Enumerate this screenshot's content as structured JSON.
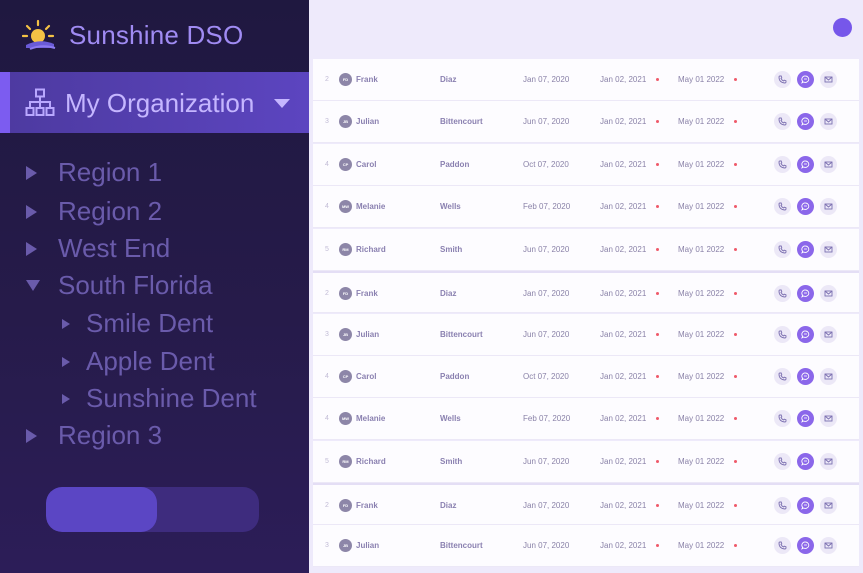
{
  "brand": {
    "name": "Sunshine DSO",
    "logo_icon": "sun-icon"
  },
  "org": {
    "label": "My Organization",
    "icon": "org-chart-icon",
    "caret_icon": "caret-down-icon"
  },
  "tree": [
    {
      "label": "Region 1",
      "expanded": false,
      "level": 0
    },
    {
      "label": "Region 2",
      "expanded": false,
      "level": 0
    },
    {
      "label": "West End",
      "expanded": false,
      "level": 0
    },
    {
      "label": "South Florida",
      "expanded": true,
      "level": 0
    },
    {
      "label": "Smile Dent",
      "expanded": false,
      "level": 1
    },
    {
      "label": "Apple Dent",
      "expanded": false,
      "level": 1
    },
    {
      "label": "Sunshine Dent",
      "expanded": false,
      "level": 1
    },
    {
      "label": "Region 3",
      "expanded": false,
      "level": 0
    }
  ],
  "toggle": {
    "fill_fraction": 0.52
  },
  "colors": {
    "accent": "#7657ea",
    "sidebar_bg": "#1f1840",
    "status_dot": "#ef5a6a"
  },
  "rows": [
    {
      "num": "2",
      "initials": "FD",
      "first": "Frank",
      "last": "Diaz",
      "date1": "Jan 07, 2020",
      "date2": "Jan 02, 2021",
      "date3": "May 01 2022"
    },
    {
      "num": "3",
      "initials": "JB",
      "first": "Julian",
      "last": "Bittencourt",
      "date1": "Jun 07, 2020",
      "date2": "Jan 02, 2021",
      "date3": "May 01 2022"
    },
    {
      "num": "4",
      "initials": "CP",
      "first": "Carol",
      "last": "Paddon",
      "date1": "Oct 07, 2020",
      "date2": "Jan 02, 2021",
      "date3": "May 01 2022"
    },
    {
      "num": "4",
      "initials": "MW",
      "first": "Melanie",
      "last": "Wells",
      "date1": "Feb 07, 2020",
      "date2": "Jan 02, 2021",
      "date3": "May 01 2022"
    },
    {
      "num": "5",
      "initials": "RM",
      "first": "Richard",
      "last": "Smith",
      "date1": "Jun 07, 2020",
      "date2": "Jan 02, 2021",
      "date3": "May 01 2022"
    },
    {
      "num": "2",
      "initials": "FD",
      "first": "Frank",
      "last": "Diaz",
      "date1": "Jan 07, 2020",
      "date2": "Jan 02, 2021",
      "date3": "May 01 2022"
    },
    {
      "num": "3",
      "initials": "JB",
      "first": "Julian",
      "last": "Bittencourt",
      "date1": "Jun 07, 2020",
      "date2": "Jan 02, 2021",
      "date3": "May 01 2022"
    },
    {
      "num": "4",
      "initials": "CP",
      "first": "Carol",
      "last": "Paddon",
      "date1": "Oct 07, 2020",
      "date2": "Jan 02, 2021",
      "date3": "May 01 2022"
    },
    {
      "num": "4",
      "initials": "MW",
      "first": "Melanie",
      "last": "Wells",
      "date1": "Feb 07, 2020",
      "date2": "Jan 02, 2021",
      "date3": "May 01 2022"
    },
    {
      "num": "5",
      "initials": "RM",
      "first": "Richard",
      "last": "Smith",
      "date1": "Jun 07, 2020",
      "date2": "Jan 02, 2021",
      "date3": "May 01 2022"
    },
    {
      "num": "2",
      "initials": "FD",
      "first": "Frank",
      "last": "Diaz",
      "date1": "Jan 07, 2020",
      "date2": "Jan 02, 2021",
      "date3": "May 01 2022"
    },
    {
      "num": "3",
      "initials": "JB",
      "first": "Julian",
      "last": "Bittencourt",
      "date1": "Jun 07, 2020",
      "date2": "Jan 02, 2021",
      "date3": "May 01 2022"
    }
  ],
  "row_actions": [
    "phone-icon",
    "chat-icon",
    "mail-icon"
  ]
}
